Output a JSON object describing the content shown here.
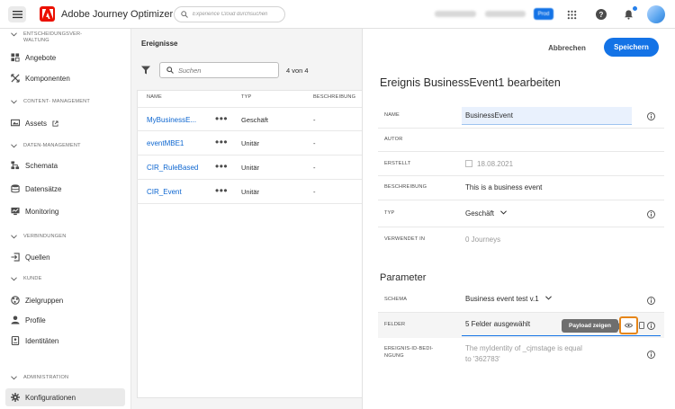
{
  "topbar": {
    "app_title": "Adobe Journey Optimizer",
    "search_placeholder": "Experience Cloud durchsuchen",
    "blurred_org": "CJM Prod NLD2",
    "blurred_sandbox": "Prod (NLD2)",
    "sandbox_badge": "Prod"
  },
  "sidenav": {
    "sections": {
      "decision": "ENTSCHEIDUNGSVER-",
      "decision_2": "WALTUNG",
      "content": "CONTENT- MANAGEMENT",
      "data": "DATEN-MANAGEMENT",
      "connections": "VERBINDUNGEN",
      "customer": "KUNDE",
      "admin": "ADMINISTRATION"
    },
    "items": {
      "offers": "Angebote",
      "components": "Komponenten",
      "assets": "Assets",
      "schemas": "Schemata",
      "datasets": "Datensätze",
      "monitoring": "Monitoring",
      "sources": "Quellen",
      "audiences": "Zielgruppen",
      "profiles": "Profile",
      "identities": "Identitäten",
      "configurations": "Konfigurationen"
    }
  },
  "events": {
    "title": "Ereignisse",
    "search_placeholder": "Suchen",
    "count": "4 von 4",
    "columns": {
      "name": "NAME",
      "type": "TYP",
      "description": "BESCHREIBUNG"
    },
    "rows": [
      {
        "name": "MyBusinessE...",
        "more": "•••",
        "type": "Geschäft",
        "description": "-"
      },
      {
        "name": "eventMBE1",
        "more": "•••",
        "type": "Unitär",
        "description": "-"
      },
      {
        "name": "CIR_RuleBased",
        "more": "•••",
        "type": "Unitär",
        "description": "-"
      },
      {
        "name": "CIR_Event",
        "more": "•••",
        "type": "Unitär",
        "description": "-"
      }
    ]
  },
  "edit": {
    "cancel_label": "Abbrechen",
    "save_label": "Speichern",
    "title": "Ereignis BusinessEvent1 bearbeiten",
    "fields": {
      "name_label": "NAME",
      "name_value": "BusinessEvent",
      "author_label": "AUTOR",
      "created_label": "ERSTELLT",
      "created_value": "18.08.2021",
      "description_label": "BESCHREIBUNG",
      "description_value": "This is a business event",
      "type_label": "TYP",
      "type_value": "Geschäft",
      "used_in_label": "VERWENDET IN",
      "used_in_value": "0 Journeys"
    },
    "parameters": {
      "title": "Parameter",
      "schema_label": "SCHEMA",
      "schema_value": "Business event test v.1",
      "fields_label": "FELDER",
      "fields_value": "5 Felder ausgewählt",
      "tooltip": "Payload zeigen",
      "event_id_label_1": "EREIGNIS-ID-BEDI-",
      "event_id_label_2": "NGUNG",
      "event_id_value_1": "The myIdentity of _cjmstage is equal",
      "event_id_value_2": "to '362783'"
    }
  }
}
